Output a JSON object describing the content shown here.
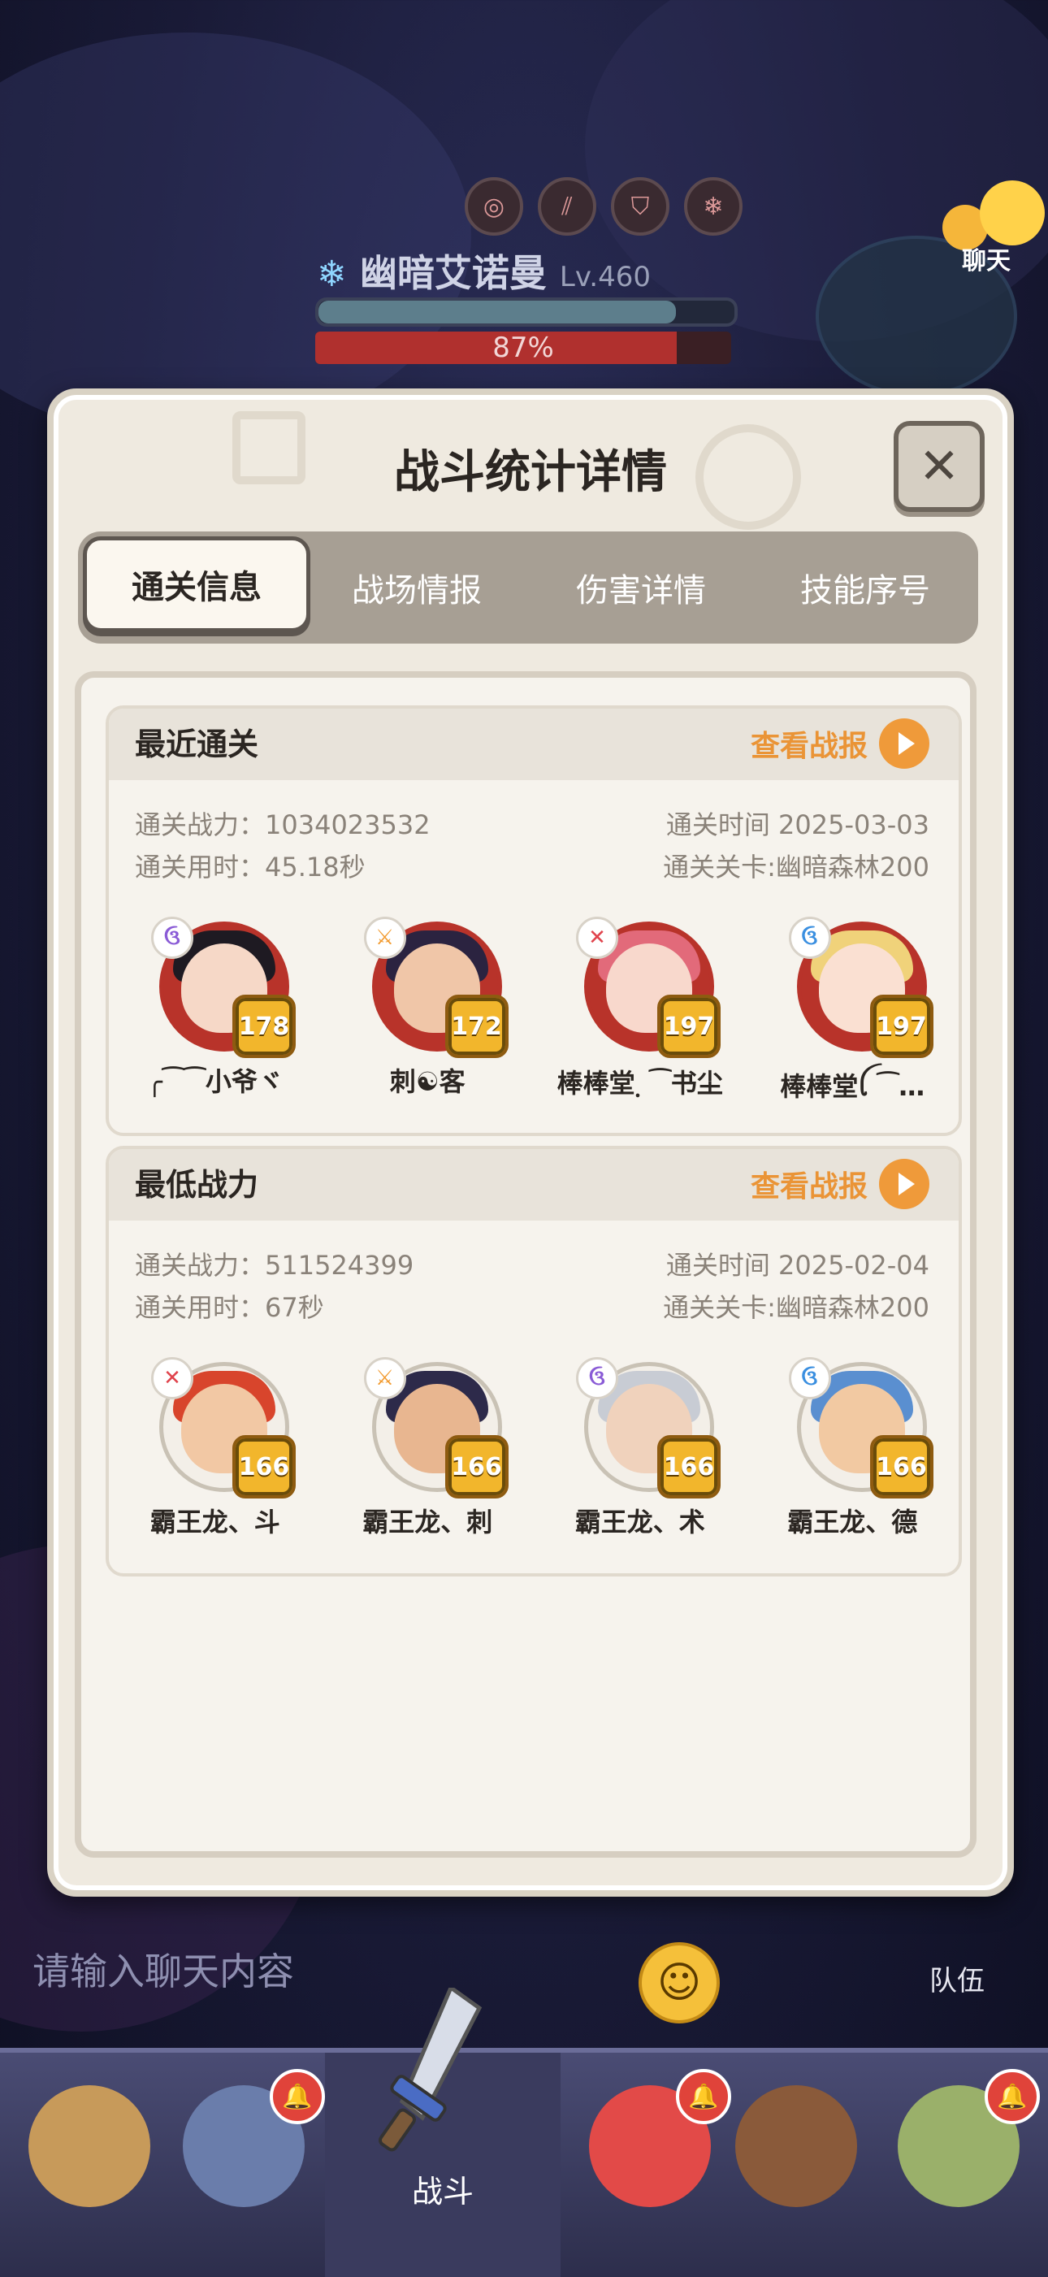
{
  "scene": {
    "boss_name": "幽暗艾诺曼",
    "boss_level": "Lv.460",
    "boss_hp_percent_text": "87%",
    "boss_hp": 0.87,
    "chat_button_label": "聊天",
    "chat_placeholder": "请输入聊天内容",
    "team_label": "队伍",
    "nav_battle_label": "战斗"
  },
  "modal": {
    "title": "战斗统计详情",
    "close_glyph": "✕",
    "tabs": [
      {
        "label": "通关信息",
        "active": true
      },
      {
        "label": "战场情报",
        "active": false
      },
      {
        "label": "伤害详情",
        "active": false
      },
      {
        "label": "技能序号",
        "active": false
      }
    ]
  },
  "recent": {
    "title": "最近通关",
    "report_label": "查看战报",
    "power_label": "通关战力：1034023532",
    "time_used_label": "通关用时：45.18秒",
    "date_label": "通关时间  2025-03-03",
    "stage_label": "通关关卡:幽暗森林200",
    "heroes": [
      {
        "name": "╭⁀⁀小爷ヾ",
        "level": "178",
        "class_icon": "swirl-icon",
        "class_color": "#8a5bd6"
      },
      {
        "name": "刺☯客",
        "level": "172",
        "class_icon": "sword-icon",
        "class_color": "#f29a2e"
      },
      {
        "name": "棒棒堂຺ ⁀书尘",
        "level": "197",
        "class_icon": "crossed-swords-icon",
        "class_color": "#e0434c"
      },
      {
        "name": "棒棒堂ꪶ ⁀…",
        "level": "197",
        "class_icon": "swirl-icon",
        "class_color": "#3a8fe0"
      }
    ]
  },
  "lowest": {
    "title": "最低战力",
    "report_label": "查看战报",
    "power_label": "通关战力：511524399",
    "time_used_label": "通关用时：67秒",
    "date_label": "通关时间  2025-02-04",
    "stage_label": "通关关卡:幽暗森林200",
    "heroes": [
      {
        "name": "霸王龙、斗",
        "level": "166",
        "class_icon": "crossed-swords-icon",
        "class_color": "#e0434c"
      },
      {
        "name": "霸王龙、刺",
        "level": "166",
        "class_icon": "sword-icon",
        "class_color": "#f29a2e"
      },
      {
        "name": "霸王龙、术",
        "level": "166",
        "class_icon": "swirl-icon",
        "class_color": "#8a5bd6"
      },
      {
        "name": "霸王龙、德",
        "level": "166",
        "class_icon": "swirl-icon",
        "class_color": "#3a8fe0"
      }
    ]
  }
}
